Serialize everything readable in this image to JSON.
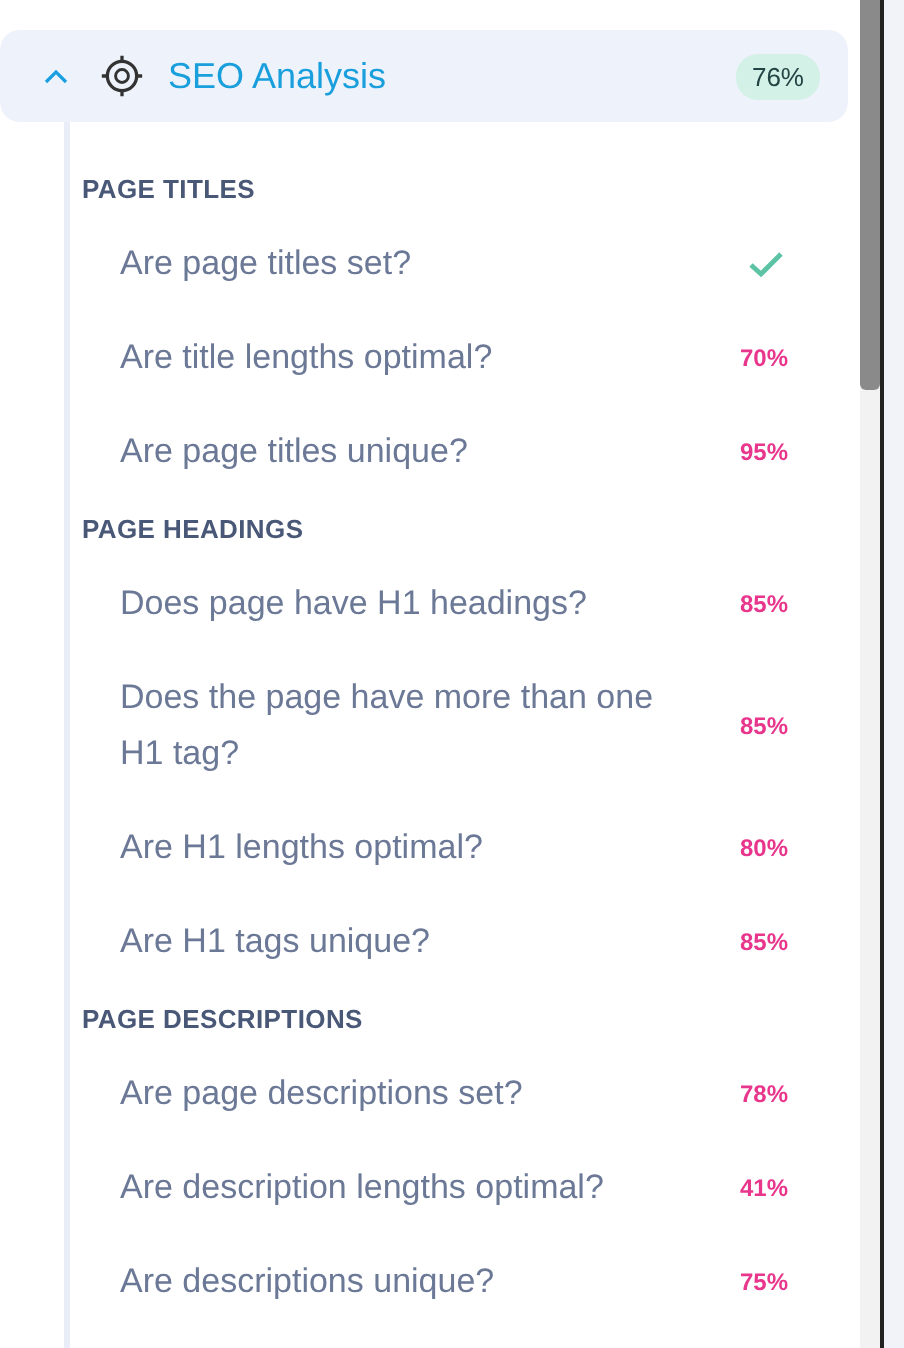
{
  "panel": {
    "title": "SEO Analysis",
    "expanded": true,
    "score": "76%",
    "sections": [
      {
        "heading": "PAGE TITLES",
        "items": [
          {
            "kind": "check",
            "label": "Are page titles set?"
          },
          {
            "kind": "score",
            "label": "Are title lengths optimal?",
            "score": "70%"
          },
          {
            "kind": "score",
            "label": "Are page titles unique?",
            "score": "95%"
          }
        ]
      },
      {
        "heading": "PAGE HEADINGS",
        "items": [
          {
            "kind": "score",
            "label": "Does page have H1 headings?",
            "score": "85%"
          },
          {
            "kind": "score",
            "label": "Does the page have more than one H1 tag?",
            "score": "85%"
          },
          {
            "kind": "score",
            "label": "Are H1 lengths optimal?",
            "score": "80%"
          },
          {
            "kind": "score",
            "label": "Are H1 tags unique?",
            "score": "85%"
          }
        ]
      },
      {
        "heading": "PAGE DESCRIPTIONS",
        "items": [
          {
            "kind": "score",
            "label": "Are page descriptions set?",
            "score": "78%"
          },
          {
            "kind": "score",
            "label": "Are description lengths optimal?",
            "score": "41%"
          },
          {
            "kind": "score",
            "label": "Are descriptions unique?",
            "score": "75%"
          }
        ]
      }
    ]
  }
}
